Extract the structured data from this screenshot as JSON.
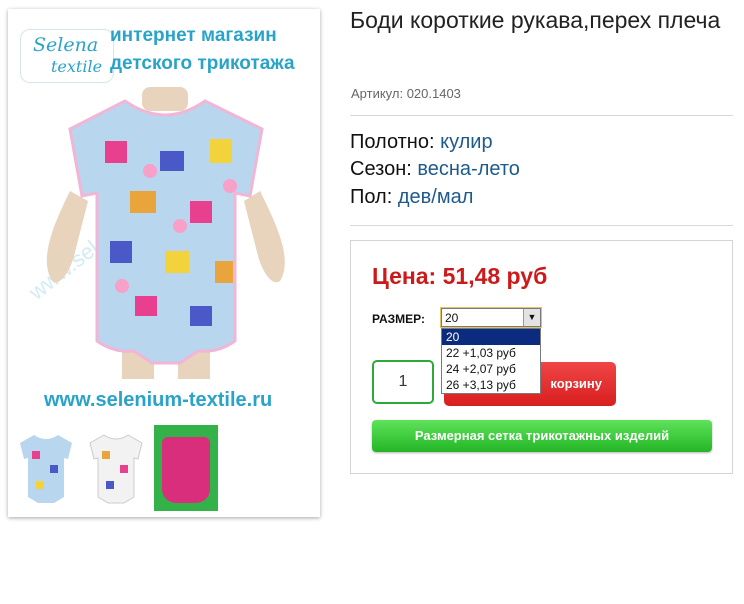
{
  "product": {
    "title": "Боди короткие рукава,перех плеча",
    "article": "Артикул: 020.1403",
    "attributes": [
      {
        "label": "Полотно:",
        "value": "кулир"
      },
      {
        "label": "Сезон:",
        "value": "весна-лето"
      },
      {
        "label": "Пол:",
        "value": "дев/мал"
      }
    ]
  },
  "image": {
    "logo_line1": "Selena",
    "logo_line2": "textile",
    "shop_line1": "интернет магазин",
    "shop_line2": "детского трикотажа",
    "url": "www.selenium-textile.ru",
    "watermark": "www.selenium-textile.ru"
  },
  "buy": {
    "price": "Цена: 51,48 руб",
    "size_label": "РАЗМЕР:",
    "size_selected": "20",
    "size_options": [
      "20",
      "22 +1,03 руб",
      "24 +2,07 руб",
      "26 +3,13 руб"
    ],
    "quantity": "1",
    "cart_button_visible_text": "корзину",
    "size_chart_button": "Размерная сетка трикотажных изделий"
  }
}
